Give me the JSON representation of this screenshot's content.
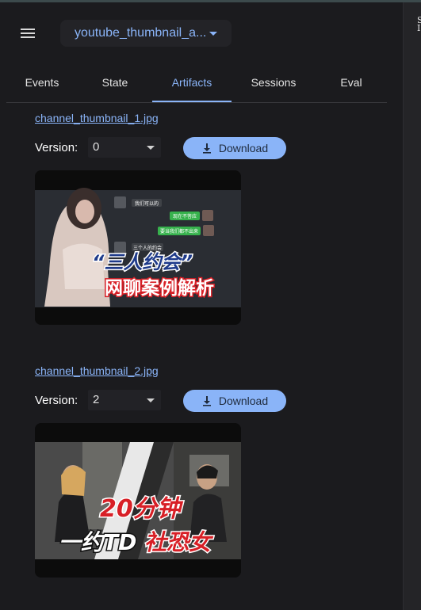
{
  "header": {
    "app_name": "youtube_thumbnail_a..."
  },
  "tabs": [
    {
      "label": "Events",
      "active": false
    },
    {
      "label": "State",
      "active": false
    },
    {
      "label": "Artifacts",
      "active": true
    },
    {
      "label": "Sessions",
      "active": false
    },
    {
      "label": "Eval",
      "active": false
    }
  ],
  "artifacts": [
    {
      "name": "channel_thumbnail_1.jpg",
      "version_label": "Version:",
      "version": "0",
      "download_label": "Download",
      "thumbnail": {
        "quote_line": "“三人约会”",
        "title_line": "网聊案例解析",
        "chat_bubbles": [
          "我们可以的",
          "现在不答应",
          "要当我们都不出来",
          "三个人的约会"
        ]
      }
    },
    {
      "name": "channel_thumbnail_2.jpg",
      "version_label": "Version:",
      "version": "2",
      "download_label": "Download",
      "thumbnail": {
        "line1": "20分钟",
        "line2_prefix": "一约TD",
        "line2_suffix": "社恐女"
      }
    }
  ],
  "colors": {
    "accent": "#8ab4f8",
    "background": "#1b1b1e",
    "button_text": "#1f2b3d",
    "thumb_red": "#d81f26"
  }
}
